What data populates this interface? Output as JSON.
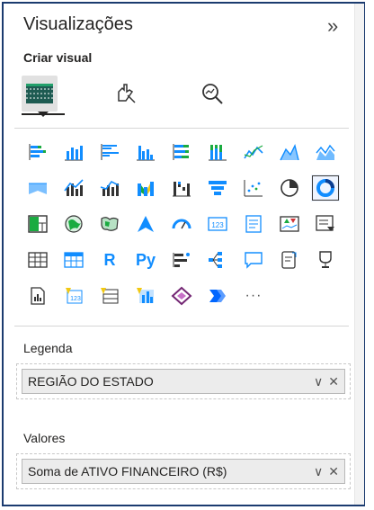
{
  "panel": {
    "title": "Visualizações",
    "collapse_label": "»",
    "subtitle": "Criar visual"
  },
  "tabs": [
    {
      "name": "fields-tab",
      "icon": "fields-grid-icon",
      "active": true
    },
    {
      "name": "format-tab",
      "icon": "format-brush-icon",
      "active": false
    },
    {
      "name": "analytics-tab",
      "icon": "analytics-magnifier-icon",
      "active": false
    }
  ],
  "visual_icons": [
    "stacked-bar-chart-icon",
    "stacked-column-chart-icon",
    "clustered-bar-chart-icon",
    "clustered-column-chart-icon",
    "100-percent-stacked-bar-icon",
    "100-percent-stacked-column-icon",
    "line-chart-icon",
    "area-chart-icon",
    "stacked-area-chart-icon",
    "ribbon-area-icon",
    "line-clustered-column-icon",
    "line-stacked-column-icon",
    "ribbon-chart-icon",
    "waterfall-chart-icon",
    "funnel-chart-icon",
    "scatter-chart-icon",
    "pie-chart-icon",
    "donut-chart-icon",
    "treemap-icon",
    "map-icon",
    "filled-map-icon",
    "azure-map-icon",
    "gauge-icon",
    "card-icon",
    "multi-row-card-icon",
    "kpi-icon",
    "slicer-icon",
    "table-icon",
    "matrix-icon",
    "r-visual-icon",
    "python-visual-icon",
    "key-influencers-icon",
    "decomposition-tree-icon",
    "qa-icon",
    "smart-narrative-icon",
    "goals-icon",
    "paginated-report-icon",
    "custom-visual-card-icon",
    "custom-visual-table-icon",
    "custom-visual-chart-icon",
    "power-apps-icon",
    "power-automate-icon",
    "more-visuals-icon"
  ],
  "visual_text": {
    "r": "R",
    "py": "Py",
    "more": "···"
  },
  "selected_icon": "donut-chart-icon",
  "wells": [
    {
      "label": "Legenda",
      "field": "REGIÃO DO ESTADO"
    },
    {
      "label": "Valores",
      "field": "Soma de ATIVO FINANCEIRO (R$)"
    }
  ],
  "well_controls": {
    "expand": "∨",
    "remove": "✕"
  },
  "colors": {
    "accent": "#118dff",
    "teal": "#1aab40",
    "dark": "#252423",
    "border": "#1b3b6f"
  }
}
